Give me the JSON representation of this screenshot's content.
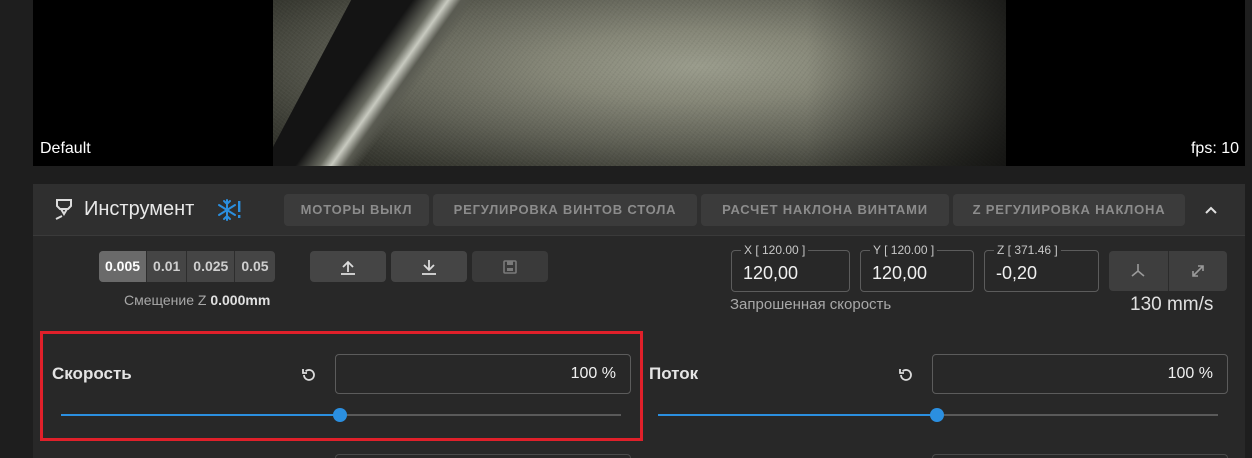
{
  "webcam": {
    "name": "Default",
    "fps": "fps: 10"
  },
  "toolhead": {
    "title": "Инструмент",
    "buttons": [
      "МОТОРЫ ВЫКЛ",
      "РЕГУЛИРОВКА ВИНТОВ СТОЛА",
      "РАСЧЕТ НАКЛОНА ВИНТАМИ",
      "Z РЕГУЛИРОВКА НАКЛОНА"
    ],
    "steps": [
      "0.005",
      "0.01",
      "0.025",
      "0.05"
    ],
    "active_step": "0.005",
    "z_offset_label": "Смещение Z",
    "z_offset_value": "0.000mm",
    "coords": {
      "x": {
        "label": "X [ 120.00 ]",
        "value": "120,00"
      },
      "y": {
        "label": "Y [ 120.00 ]",
        "value": "120,00"
      },
      "z": {
        "label": "Z [ 371.46 ]",
        "value": "-0,20"
      }
    },
    "requested_speed_label": "Запрошенная скорость",
    "requested_speed_value": "130 mm/s"
  },
  "speed_factor": {
    "label": "Скорость",
    "value": "100 %",
    "fraction": 0.5
  },
  "flow_factor": {
    "label": "Поток",
    "value": "100 %",
    "fraction": 0.5
  },
  "colors": {
    "accent": "#2b8fe0",
    "highlight": "#e0202a"
  },
  "icons": [
    "nozzle-icon",
    "snowflake-warning-icon",
    "chevron-up-icon",
    "arrow-up-bar-icon",
    "arrow-down-bar-icon",
    "save-icon",
    "axes-icon",
    "diagonal-arrow-icon",
    "reset-icon"
  ]
}
